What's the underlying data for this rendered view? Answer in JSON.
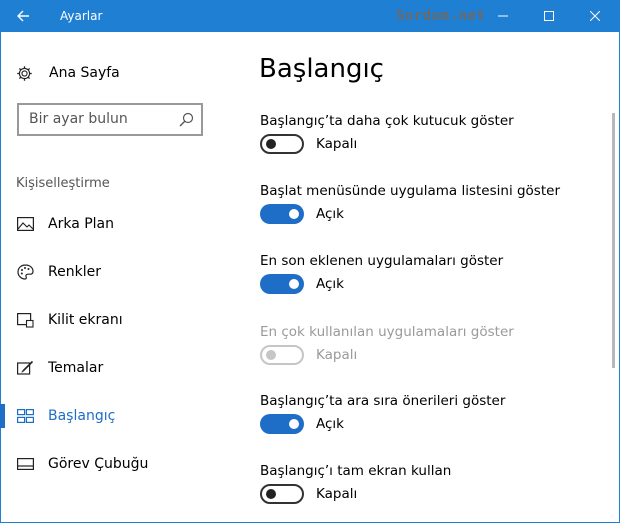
{
  "window": {
    "title": "Ayarlar",
    "watermark": "Sordum.net",
    "accent": "#1e7fd3"
  },
  "sidebar": {
    "home_label": "Ana Sayfa",
    "search_placeholder": "Bir ayar bulun",
    "section_label": "Kişiselleştirme",
    "items": [
      {
        "label": "Arka Plan",
        "icon": "image-icon",
        "active": false
      },
      {
        "label": "Renkler",
        "icon": "palette-icon",
        "active": false
      },
      {
        "label": "Kilit ekranı",
        "icon": "lock-screen-icon",
        "active": false
      },
      {
        "label": "Temalar",
        "icon": "themes-icon",
        "active": false
      },
      {
        "label": "Başlangıç",
        "icon": "start-icon",
        "active": true
      },
      {
        "label": "Görev Çubuğu",
        "icon": "taskbar-icon",
        "active": false
      }
    ]
  },
  "main": {
    "title": "Başlangıç",
    "settings": [
      {
        "label": "Başlangıç’ta daha çok kutucuk göster",
        "state": "Kapalı",
        "on": false,
        "enabled": true
      },
      {
        "label": "Başlat menüsünde uygulama listesini göster",
        "state": "Açık",
        "on": true,
        "enabled": true
      },
      {
        "label": "En son eklenen uygulamaları göster",
        "state": "Açık",
        "on": true,
        "enabled": true
      },
      {
        "label": "En çok kullanılan uygulamaları göster",
        "state": "Kapalı",
        "on": false,
        "enabled": false
      },
      {
        "label": "Başlangıç’ta ara sıra önerileri göster",
        "state": "Açık",
        "on": true,
        "enabled": true
      },
      {
        "label": "Başlangıç’ı tam ekran kullan",
        "state": "Kapalı",
        "on": false,
        "enabled": true
      }
    ]
  }
}
